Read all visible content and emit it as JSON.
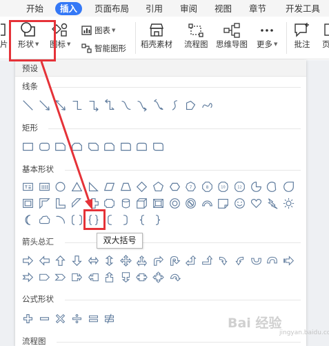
{
  "colors": {
    "accent": "#3478f6",
    "highlight": "#e53238",
    "icon": "#5d7a9c"
  },
  "tabs": [
    "开始",
    "插入",
    "页面布局",
    "引用",
    "审阅",
    "视图",
    "章节",
    "开发工具"
  ],
  "ribbon": {
    "left_partial": "片",
    "shape": "形状",
    "icon_lib": "图标",
    "chart": "图表",
    "smart_art": "智能图形",
    "material": "稻壳素材",
    "flowchart": "流程图",
    "mindmap": "思维导图",
    "more": "更多",
    "comment": "批注",
    "right_partial": "页"
  },
  "panel": {
    "preset": "预设",
    "sections": [
      "线条",
      "矩形",
      "基本形状",
      "箭头总汇",
      "公式形状",
      "流程图"
    ],
    "tooltip": "双大括号"
  },
  "watermark": {
    "main": "Bai 经验",
    "sub": "jingyan.baidu.com"
  }
}
